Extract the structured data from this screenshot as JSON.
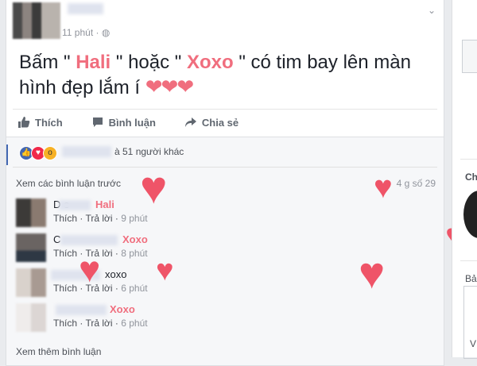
{
  "post": {
    "time": "11 phút",
    "text_part1": "Bấm \" ",
    "hali": "Hali",
    "text_part2": " \" hoặc \" ",
    "xoxo": "Xoxo",
    "text_part3": " \" có tim bay lên màn hình đẹp lắm í ",
    "hearts": "❤❤❤"
  },
  "actions": {
    "like": "Thích",
    "comment": "Bình luận",
    "share": "Chia sẻ"
  },
  "reactions": {
    "text": "à 51 người khác"
  },
  "comments_header": {
    "prev_link": "Xem các bình luận trước",
    "count": "4 g số 29"
  },
  "comments": [
    {
      "name_fragment": "D e",
      "tag": "Hali",
      "like": "Thích",
      "reply": "Trả lời",
      "time": "9 phút"
    },
    {
      "name_fragment": "C",
      "tag": "Xoxo",
      "like": "Thích",
      "reply": "Trả lời",
      "time": "8 phút"
    },
    {
      "name_fragment": "",
      "tag": "xoxo",
      "like": "Thích",
      "reply": "Trả lời",
      "time": "6 phút"
    },
    {
      "name_fragment": "",
      "tag": "Xoxo",
      "like": "Thích",
      "reply": "Trả lời",
      "time": "6 phút"
    }
  ],
  "more_comments": "Xem thêm bình luận",
  "sidebar": {
    "label_ch": "Ch",
    "label_ba": "Bả",
    "label_v": "V"
  },
  "colors": {
    "accent_pink": "#f06e7e",
    "heart": "#ef5468",
    "fb_blue": "#4267b2"
  }
}
